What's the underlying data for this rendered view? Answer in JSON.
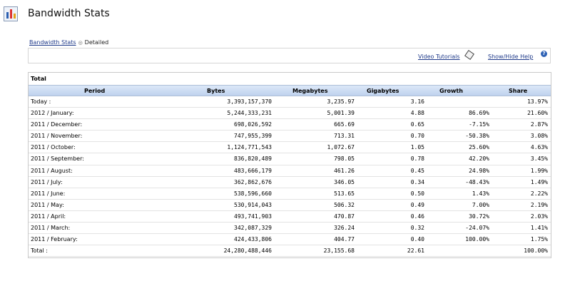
{
  "page": {
    "title": "Bandwidth Stats"
  },
  "breadcrumb": {
    "link": "Bandwidth Stats",
    "current": "Detailed"
  },
  "toolbar": {
    "video_tutorials": "Video Tutorials",
    "show_hide_help": "Show/Hide Help"
  },
  "table": {
    "title": "Total",
    "headers": [
      "Period",
      "Bytes",
      "Megabytes",
      "Gigabytes",
      "Growth",
      "Share"
    ],
    "rows": [
      {
        "period": "Today :",
        "bytes": "3,393,157,370",
        "mb": "3,235.97",
        "gb": "3.16",
        "growth": "",
        "share": "13.97%"
      },
      {
        "period": "2012 / January:",
        "bytes": "5,244,333,231",
        "mb": "5,001.39",
        "gb": "4.88",
        "growth": "86.69%",
        "share": "21.60%"
      },
      {
        "period": "2011 / December:",
        "bytes": "698,026,592",
        "mb": "665.69",
        "gb": "0.65",
        "growth": "-7.15%",
        "share": "2.87%"
      },
      {
        "period": "2011 / November:",
        "bytes": "747,955,399",
        "mb": "713.31",
        "gb": "0.70",
        "growth": "-50.38%",
        "share": "3.08%"
      },
      {
        "period": "2011 / October:",
        "bytes": "1,124,771,543",
        "mb": "1,072.67",
        "gb": "1.05",
        "growth": "25.60%",
        "share": "4.63%"
      },
      {
        "period": "2011 / September:",
        "bytes": "836,820,489",
        "mb": "798.05",
        "gb": "0.78",
        "growth": "42.20%",
        "share": "3.45%"
      },
      {
        "period": "2011 / August:",
        "bytes": "483,666,179",
        "mb": "461.26",
        "gb": "0.45",
        "growth": "24.98%",
        "share": "1.99%"
      },
      {
        "period": "2011 / July:",
        "bytes": "362,862,676",
        "mb": "346.05",
        "gb": "0.34",
        "growth": "-48.43%",
        "share": "1.49%"
      },
      {
        "period": "2011 / June:",
        "bytes": "538,596,660",
        "mb": "513.65",
        "gb": "0.50",
        "growth": "1.43%",
        "share": "2.22%"
      },
      {
        "period": "2011 / May:",
        "bytes": "530,914,043",
        "mb": "506.32",
        "gb": "0.49",
        "growth": "7.00%",
        "share": "2.19%"
      },
      {
        "period": "2011 / April:",
        "bytes": "493,741,903",
        "mb": "470.87",
        "gb": "0.46",
        "growth": "30.72%",
        "share": "2.03%"
      },
      {
        "period": "2011 / March:",
        "bytes": "342,087,329",
        "mb": "326.24",
        "gb": "0.32",
        "growth": "-24.07%",
        "share": "1.41%"
      },
      {
        "period": "2011 / February:",
        "bytes": "424,433,806",
        "mb": "404.77",
        "gb": "0.40",
        "growth": "100.00%",
        "share": "1.75%"
      },
      {
        "period": "Total :",
        "bytes": "24,280,488,446",
        "mb": "23,155.68",
        "gb": "22.61",
        "growth": "",
        "share": "100.00%"
      }
    ]
  },
  "icons": {
    "page": "bar-chart-icon",
    "video": "tag-icon",
    "help": "help-icon"
  },
  "colors": {
    "link": "#1f3a8a",
    "header_bg": "#c7d7ef",
    "help_icon": "#2f62b5"
  }
}
